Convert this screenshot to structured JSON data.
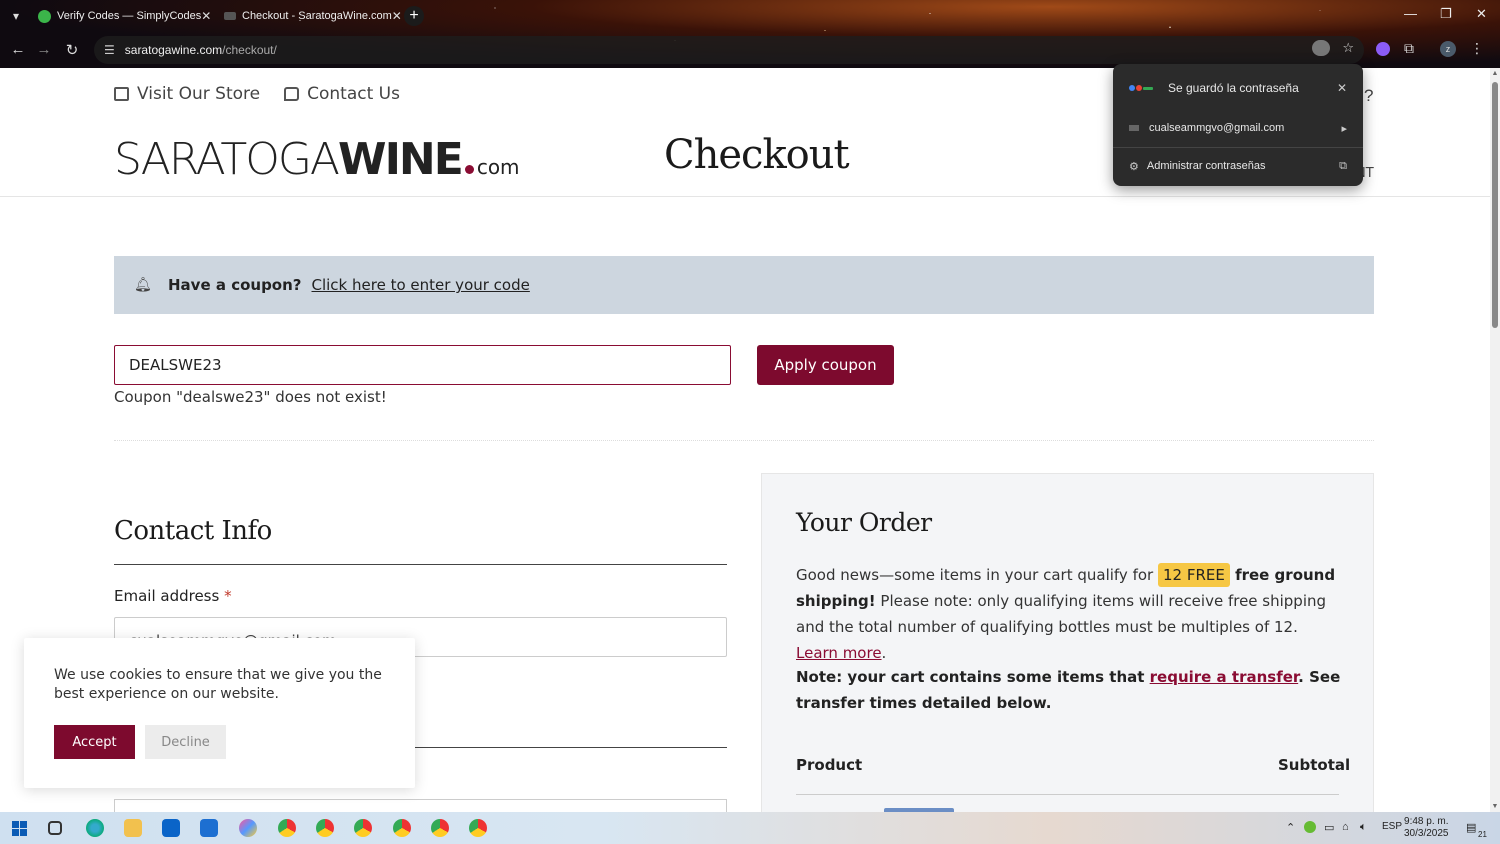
{
  "browser": {
    "tabs": [
      {
        "title": "Verify Codes — SimplyCodes",
        "close": "✕"
      },
      {
        "title": "Checkout - SaratogaWine.com",
        "close": "✕"
      }
    ],
    "new_tab": "+",
    "url_domain": "saratogawine.com",
    "url_path": "/checkout/",
    "window_controls": [
      "—",
      "❐",
      "✕"
    ]
  },
  "password_popup": {
    "title": "Se guardó la contraseña",
    "close": "✕",
    "account": "cualseammgvo@gmail.com",
    "manage": "Administrar contraseñas",
    "arrow": "▸",
    "external": "⧉"
  },
  "site": {
    "nav": [
      {
        "label": "Visit Our Store"
      },
      {
        "label": "Contact Us"
      }
    ],
    "logo_part1": "SARATOGA",
    "logo_part2": "WINE",
    "logo_part3": "com",
    "page_title": "Checkout",
    "header_partial_q": "?",
    "header_partial_nt": "NT"
  },
  "coupon": {
    "question": "Have a coupon?",
    "link": "Click here to enter your code",
    "input_value": "DEALSWE23",
    "apply_label": "Apply coupon",
    "error": "Coupon \"dealswe23\" does not exist!"
  },
  "contact": {
    "title": "Contact Info",
    "email_label": "Email address",
    "required_mark": "*",
    "email_value": "cualseammgvo@gmail.com"
  },
  "order": {
    "title": "Your Order",
    "text1": "Good news—some items in your cart qualify for ",
    "highlight": "12 FREE",
    "text2": " free ground shipping!",
    "text3": " Please note: only qualifying items will receive free shipping and the total number of qualifying bottles must be multiples of 12. ",
    "learn_more": "Learn more",
    "period": ".",
    "note1": "Note: your cart contains some items that ",
    "note_link": "require a transfer",
    "note2": ". See transfer times detailed below.",
    "col_product": "Product",
    "col_subtotal": "Subtotal"
  },
  "cookie": {
    "text": "We use cookies to ensure that we give you the best experience on our website.",
    "accept": "Accept",
    "decline": "Decline"
  },
  "taskbar": {
    "lang": "ESP",
    "time": "9:48 p. m.",
    "date": "30/3/2025",
    "notif_count": "21"
  },
  "colors": {
    "brand": "#7d0a2e",
    "highlight": "#f6c744",
    "coupon_bar": "#cdd6df"
  }
}
